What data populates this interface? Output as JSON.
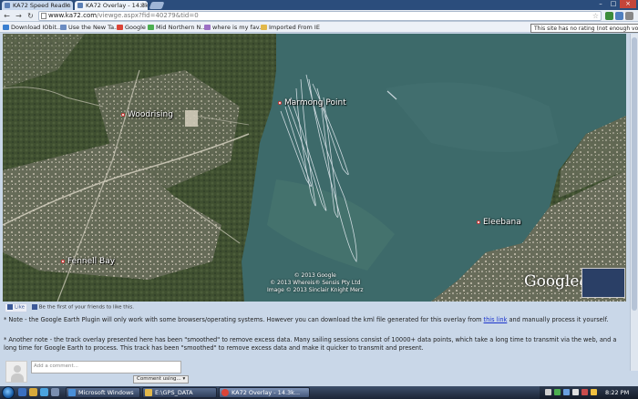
{
  "browser": {
    "tabs": [
      {
        "title": "KA72 Speed Readin"
      },
      {
        "title": "KA72 Overlay - 14.3k"
      }
    ],
    "address": {
      "domain": "www.ka72.com",
      "path": "/viewge.aspx?fid=40279&tid=0"
    },
    "bookmarks": [
      {
        "label": "Download IObit..."
      },
      {
        "label": "Use the New Ta..."
      },
      {
        "label": "Google"
      },
      {
        "label": "Mid Northern N..."
      },
      {
        "label": "where is my fav..."
      },
      {
        "label": "Imported From IE"
      }
    ],
    "tooltip": "This site has no rating (not enough votes)"
  },
  "map": {
    "labels": {
      "woodrising": "Woodrising",
      "marmong_point": "Marmong Point",
      "eleebana": "Eleebana",
      "fennell_bay": "Fennell Bay"
    },
    "copyright": [
      "© 2013 Google",
      "© 2013 Whereis® Sensis Pty Ltd",
      "Image © 2013 Sinclair Knight Merz"
    ],
    "logo": {
      "brand": "Google",
      "product": "earth"
    },
    "colors": {
      "water": "#3d6a6a",
      "land": "#4a5a3a",
      "track": "#e8eef5"
    }
  },
  "page": {
    "like": {
      "button": "Like",
      "text": "Be the first of your friends to like this."
    },
    "note1": {
      "before": "* Note - the Google Earth Plugin will only work with some browsers/operating systems. However you can download the kml file generated for this overlay from ",
      "link": "this link",
      "after": " and manually process it yourself."
    },
    "note2": "* Another note - the track overlay presented here has been \"smoothed\" to remove excess data. Many sailing sessions consist of 10000+ data points, which take a long time to transmit via the web, and a long time for Google Earth to process. This track has been \"smoothed\" to remove excess data and make it quicker to transmit and present.",
    "comment": {
      "placeholder": "Add a comment...",
      "button": "Comment using..."
    }
  },
  "taskbar": {
    "tasks": [
      {
        "label": "Microsoft Windows"
      },
      {
        "label": "E:\\GPS_DATA"
      },
      {
        "label": "KA72 Overlay - 14.3k..."
      }
    ],
    "clock": "8:22 PM"
  }
}
